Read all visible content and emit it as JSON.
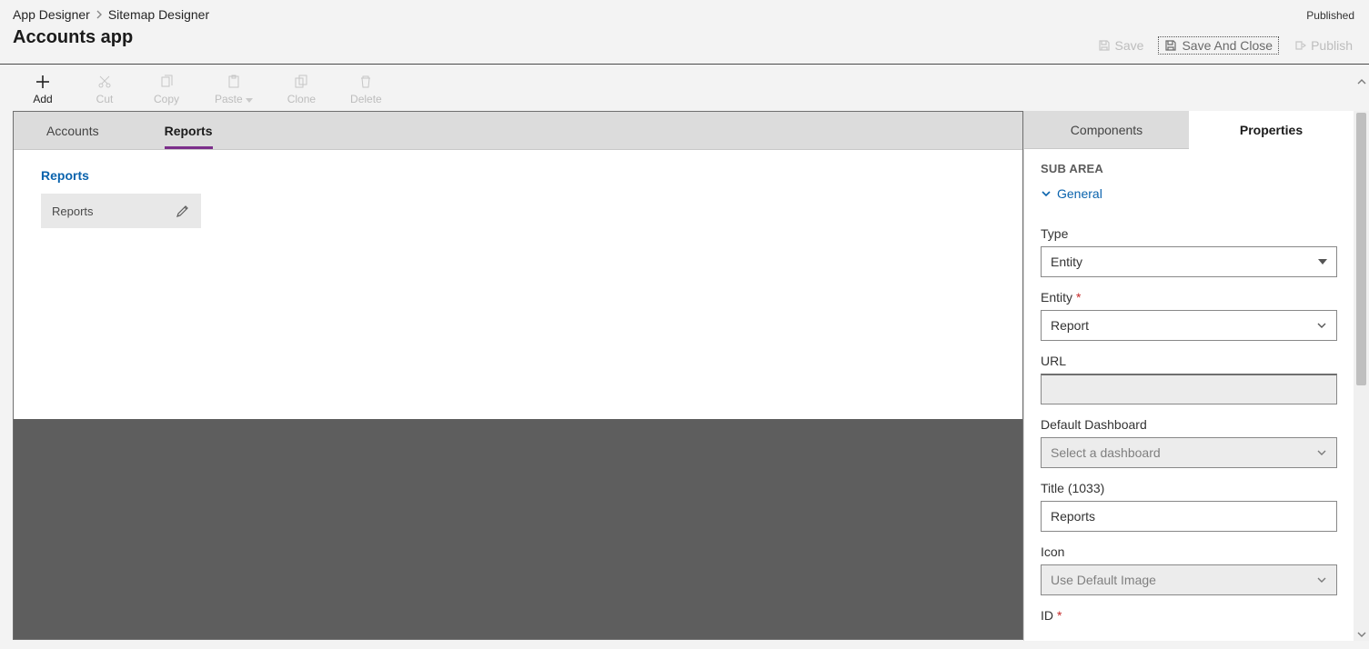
{
  "header": {
    "breadcrumb": {
      "root": "App Designer",
      "current": "Sitemap Designer"
    },
    "title": "Accounts app",
    "status": "Published",
    "actions": {
      "save": "Save",
      "save_close": "Save And Close",
      "publish": "Publish"
    }
  },
  "toolbar": {
    "add": "Add",
    "cut": "Cut",
    "copy": "Copy",
    "paste": "Paste",
    "clone": "Clone",
    "delete": "Delete"
  },
  "canvas": {
    "tabs": [
      {
        "label": "Accounts",
        "active": false
      },
      {
        "label": "Reports",
        "active": true
      }
    ],
    "group": {
      "title": "Reports"
    },
    "subarea": {
      "label": "Reports"
    }
  },
  "panel": {
    "tabs": {
      "components": "Components",
      "properties": "Properties"
    },
    "heading": "SUB AREA",
    "section": "General",
    "fields": {
      "type": {
        "label": "Type",
        "value": "Entity"
      },
      "entity": {
        "label": "Entity",
        "required": true,
        "value": "Report"
      },
      "url": {
        "label": "URL",
        "value": ""
      },
      "default_dashboard": {
        "label": "Default Dashboard",
        "placeholder": "Select a dashboard"
      },
      "title": {
        "label": "Title (1033)",
        "value": "Reports"
      },
      "icon": {
        "label": "Icon",
        "value": "Use Default Image"
      },
      "id": {
        "label": "ID",
        "required": true
      }
    }
  }
}
